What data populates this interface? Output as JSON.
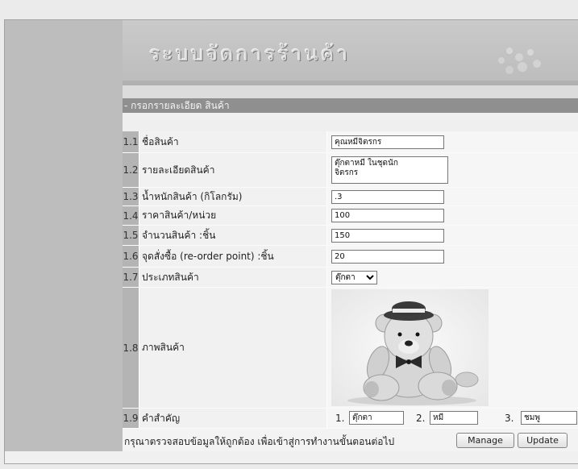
{
  "app": {
    "title": "ระบบจัดการร้านค้า"
  },
  "section": {
    "title": "- กรอกรายละเอียด สินค้า"
  },
  "form": {
    "product_name": {
      "num": "1.1",
      "label": "ชื่อสินค้า",
      "value": "คุณหมีจิตรกร"
    },
    "description": {
      "num": "1.2",
      "label": "รายละเอียดสินค้า",
      "value": "ตุ๊กตาหมี ในชุดนัก\nจิตรกร"
    },
    "weight": {
      "num": "1.3",
      "label": "น้ำหนักสินค้า (กิโลกรัม)",
      "value": ".3"
    },
    "price": {
      "num": "1.4",
      "label": "ราคาสินค้า/หน่วย",
      "value": "100"
    },
    "quantity": {
      "num": "1.5",
      "label": "จำนวนสินค้า :ชิ้น",
      "value": "150"
    },
    "reorder_point": {
      "num": "1.6",
      "label": "จุดสั่งซื้อ (re-order point) :ชิ้น",
      "value": "20"
    },
    "category": {
      "num": "1.7",
      "label": "ประเภทสินค้า",
      "selected": "ตุ๊กตา"
    },
    "image": {
      "num": "1.8",
      "label": "ภาพสินค้า",
      "icon": "teddy-bear-photo"
    },
    "keywords": {
      "num": "1.9",
      "label": "คำสำคัญ",
      "items": [
        {
          "num": "1.",
          "value": "ตุ๊กตา"
        },
        {
          "num": "2.",
          "value": "หมี"
        },
        {
          "num": "3.",
          "value": "ชมพู"
        }
      ]
    }
  },
  "footer": {
    "notice": "กรุณาตรวจสอบข้อมูลให้ถูกต้อง เพื่อเข้าสู่การทำงานขั้นตอนต่อไป",
    "manage_label": "Manage",
    "update_label": "Update"
  },
  "colors": {
    "page-bg": "#ebebeb",
    "left-panel": "#bdbdbd",
    "section-bar": "#8f8f8f",
    "number-cell": "#b4b4b4",
    "label-cell": "#f1f1f1",
    "value-cell": "#f6f6f6"
  }
}
